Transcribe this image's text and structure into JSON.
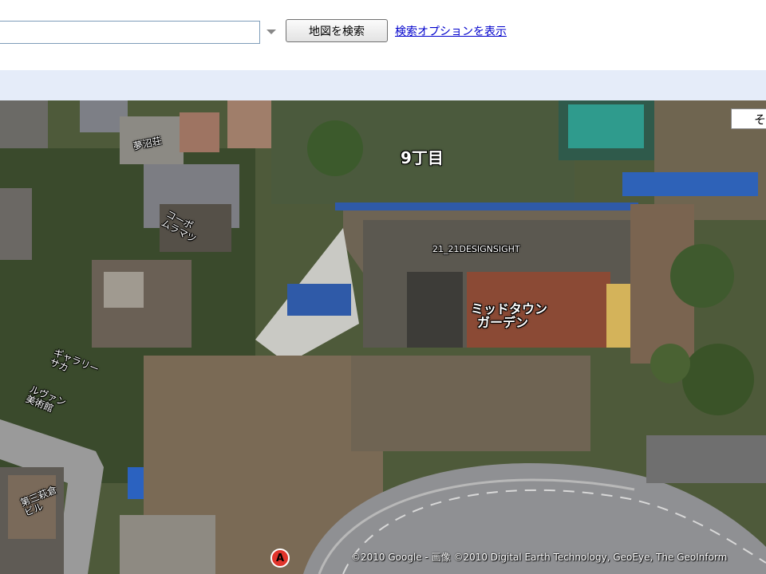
{
  "search": {
    "value": "",
    "button_label": "地図を検索",
    "options_link": "検索オプションを表示"
  },
  "map": {
    "corner_label": "そ",
    "labels": {
      "district": "9丁目",
      "designsight": "21_21DESIGNSIGHT",
      "midtown_line1": "ミッドタウン",
      "midtown_line2": "ガーデン",
      "musashiso": "夢沼荘",
      "corpo_line1": "コーポ",
      "corpo_line2": "ムラマツ",
      "gallery_line1": "ギャラリー",
      "gallery_line2": "サカ",
      "museum_line1": "ルヴァン",
      "museum_line2": "美術館",
      "building_line1": "第三萩倉",
      "building_line2": "ビル"
    },
    "marker_label": "A",
    "copyright": "©2010 Google - 画像 ©2010 Digital Earth Technology, GeoEye, The GeoInform"
  }
}
